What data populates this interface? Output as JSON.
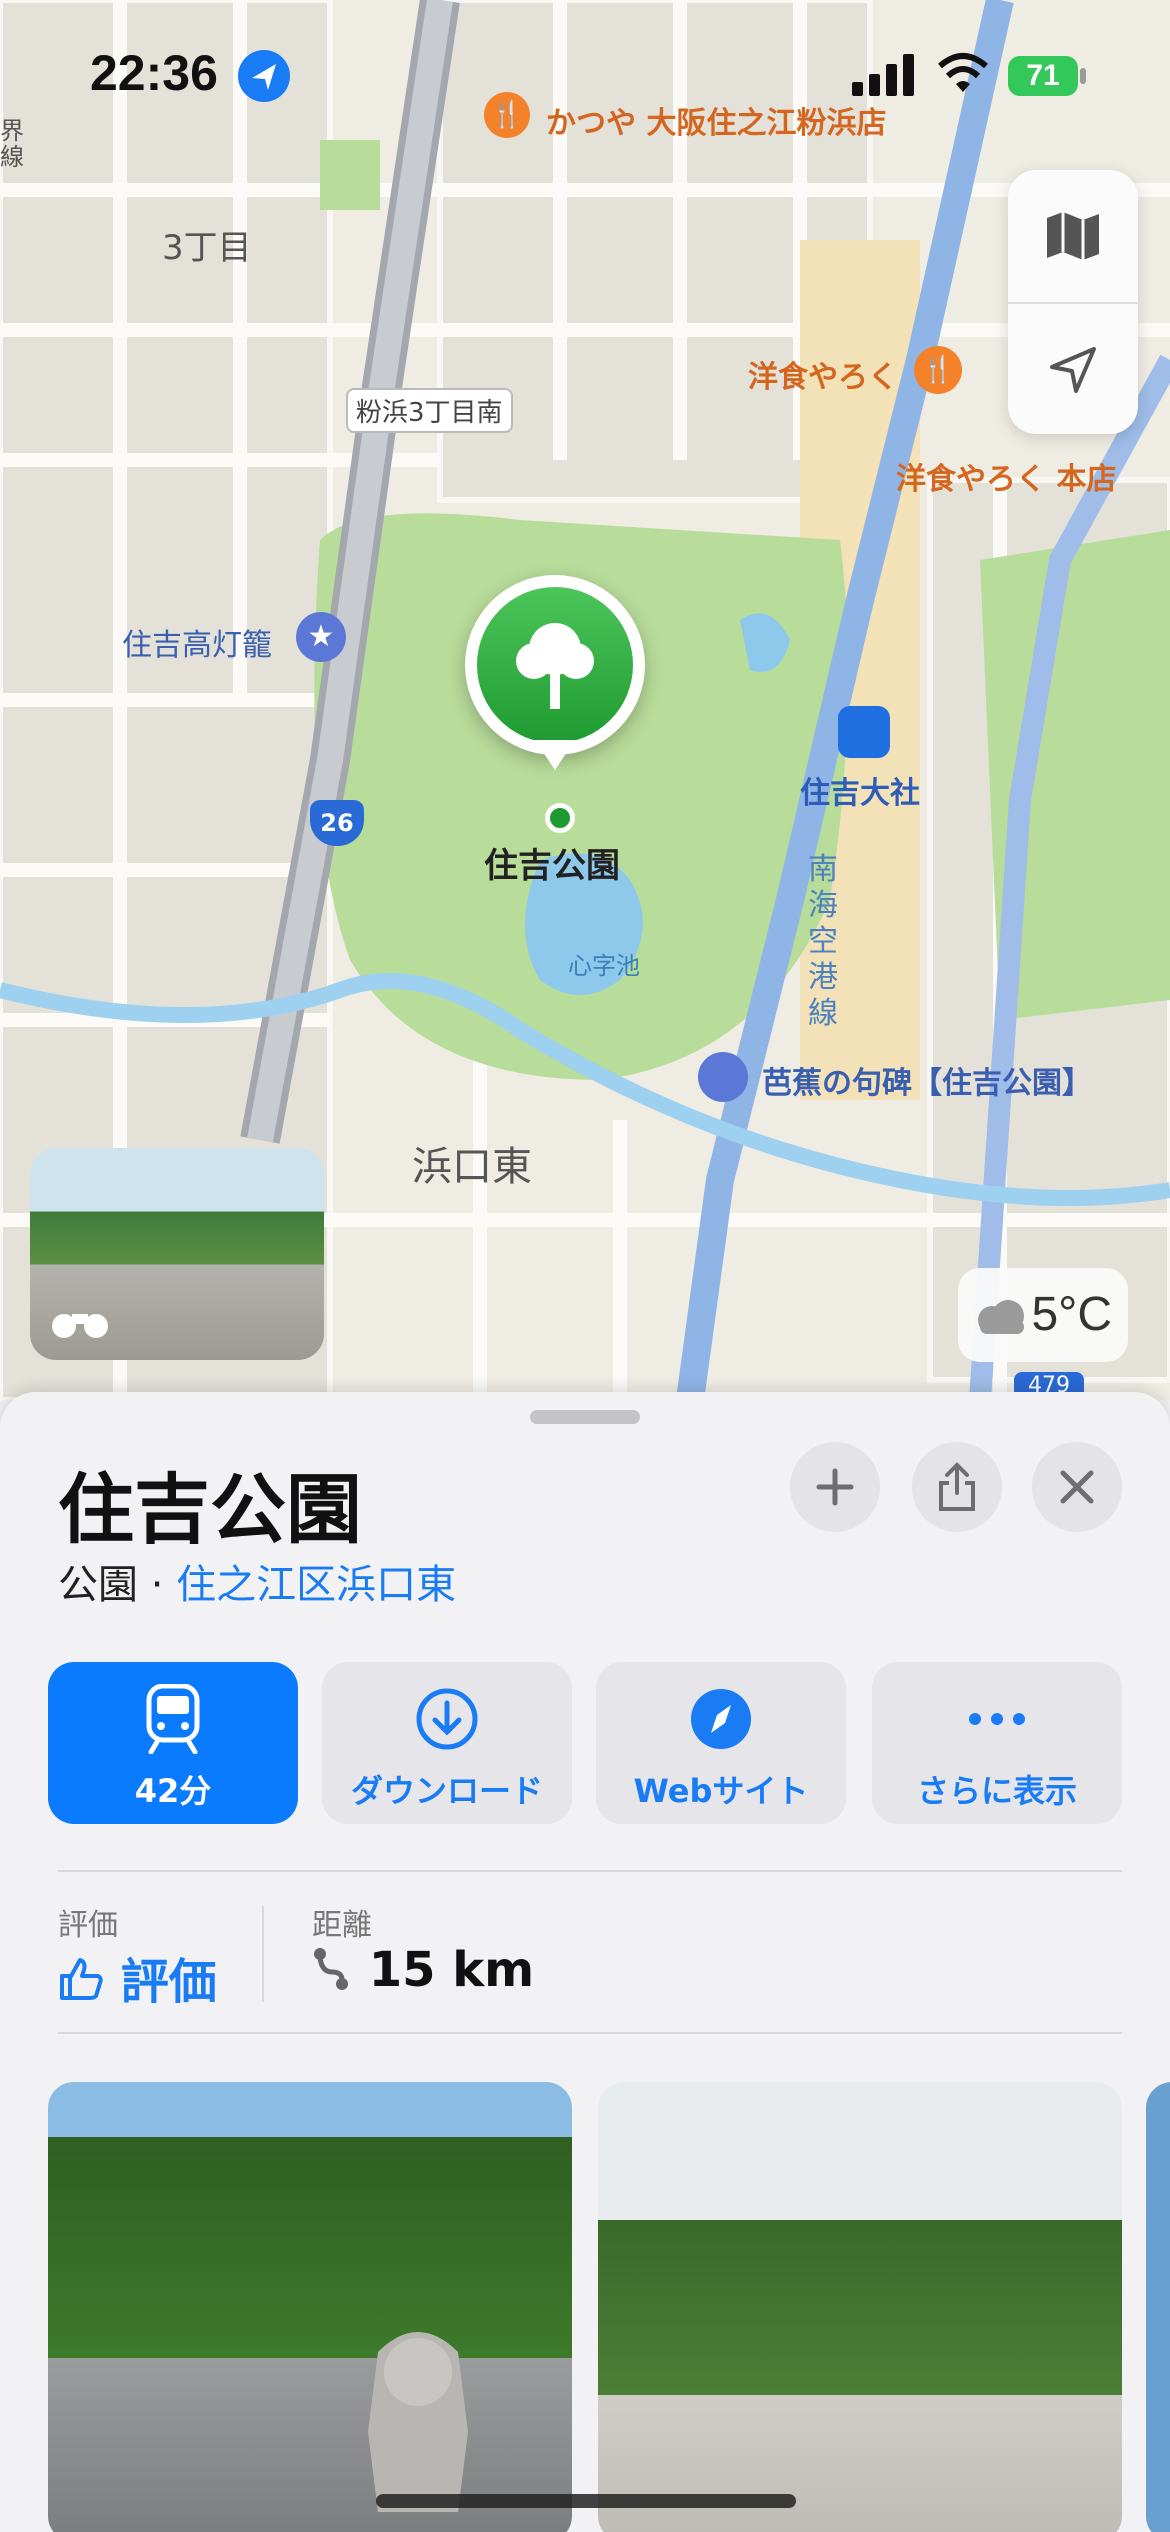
{
  "status_bar": {
    "time": "22:36",
    "battery": "71"
  },
  "map": {
    "labels": {
      "area_3chome": "3丁目",
      "katsuya": "かつや 大阪住之江粉浜店",
      "yoshoku_yaroku": "洋食やろく",
      "yoshoku_yaroku_honten": "洋食やろく 本店",
      "road_junction": "粉浜3丁目南",
      "takadoro": "住吉高灯籠",
      "station": "住吉大社",
      "route": "26",
      "park": "住吉公園",
      "pond": "心字池",
      "nankai": "南海空港線",
      "basho": "芭蕉の句碑【住吉公園】",
      "hamaguchi": "浜口東",
      "route479": "479",
      "edge_left": "界線"
    },
    "weather": "5°C"
  },
  "place": {
    "name": "住吉公園",
    "category": "公園",
    "separator": " · ",
    "location": "住之江区浜口東",
    "actions": [
      {
        "label": "42分",
        "icon": "train-icon"
      },
      {
        "label": "ダウンロード",
        "icon": "download-icon"
      },
      {
        "label": "Webサイト",
        "icon": "compass-icon"
      },
      {
        "label": "さらに表示",
        "icon": "more-icon"
      }
    ],
    "stats": {
      "rating_label": "評価",
      "rating_value": "評価",
      "distance_label": "距離",
      "distance_value": "15 km"
    }
  },
  "colors": {
    "accent": "#0a7aff",
    "park_green": "#1f9a32"
  }
}
